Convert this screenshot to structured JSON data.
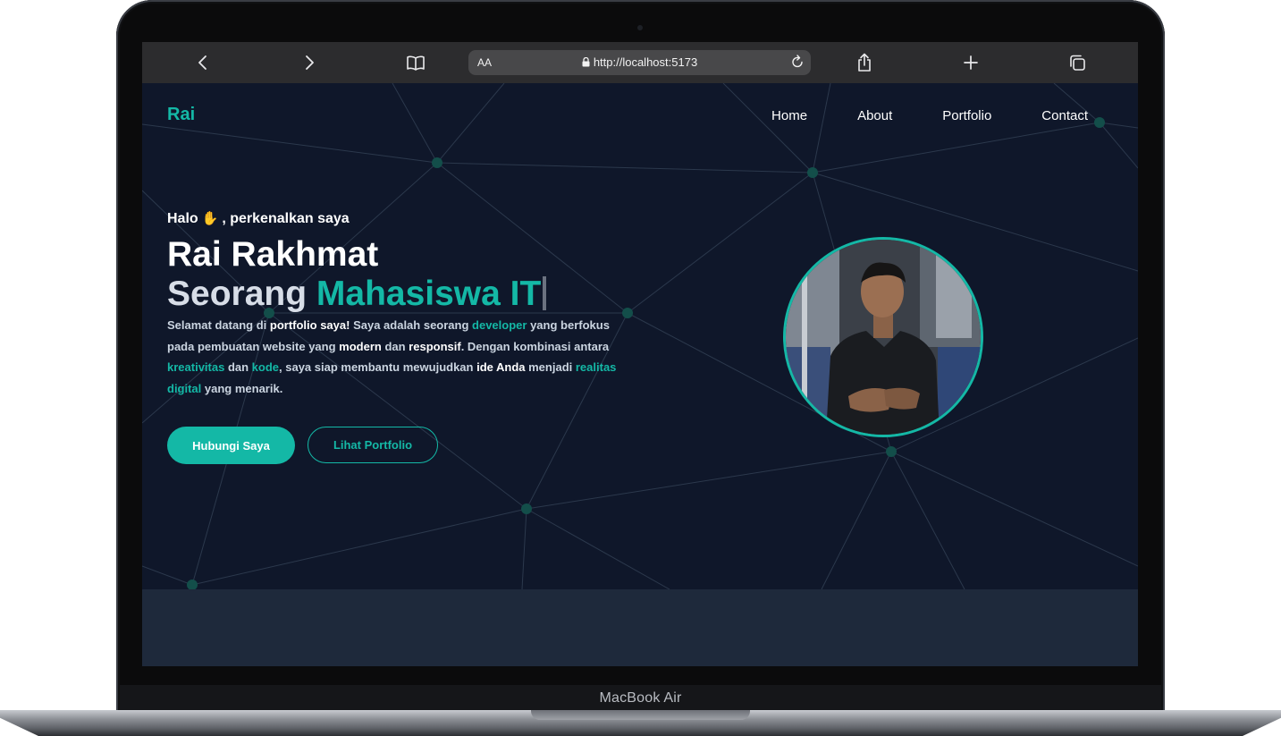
{
  "browser": {
    "url": "http://localhost:5173",
    "text_size_label": "AA"
  },
  "device_label": "MacBook Air",
  "site": {
    "logo": "Rai",
    "nav": [
      "Home",
      "About",
      "Portfolio",
      "Contact"
    ]
  },
  "hero": {
    "greeting_prefix": "Halo",
    "greeting_suffix": ", perkenalkan saya",
    "name": "Rai Rakhmat",
    "subtitle_prefix": "Seorang",
    "subtitle_accent": "Mahasiswa IT",
    "description_parts": [
      {
        "text": "Selamat datang di ",
        "style": "normal"
      },
      {
        "text": "portfolio saya!",
        "style": "white"
      },
      {
        "text": " Saya adalah seorang ",
        "style": "normal"
      },
      {
        "text": "developer",
        "style": "teal"
      },
      {
        "text": " yang berfokus pada pembuatan website yang ",
        "style": "normal"
      },
      {
        "text": "modern",
        "style": "white"
      },
      {
        "text": " dan ",
        "style": "normal"
      },
      {
        "text": "responsif",
        "style": "white"
      },
      {
        "text": ". Dengan kombinasi antara ",
        "style": "normal"
      },
      {
        "text": "kreativitas",
        "style": "teal"
      },
      {
        "text": " dan ",
        "style": "normal"
      },
      {
        "text": "kode",
        "style": "teal"
      },
      {
        "text": ", saya siap membantu mewujudkan ",
        "style": "normal"
      },
      {
        "text": "ide Anda",
        "style": "white"
      },
      {
        "text": " menjadi ",
        "style": "normal"
      },
      {
        "text": "realitas digital",
        "style": "teal"
      },
      {
        "text": " yang menarik.",
        "style": "normal"
      }
    ],
    "primary_button": "Hubungi Saya",
    "secondary_button": "Lihat Portfolio"
  },
  "colors": {
    "accent": "#14b8a6",
    "background": "#0f172a",
    "section_background": "#1e293b"
  },
  "icons": {
    "back": "chevron-left-icon",
    "forward": "chevron-right-icon",
    "reader": "book-icon",
    "lock": "lock-icon",
    "reload": "reload-icon",
    "share": "share-icon",
    "new_tab": "plus-icon",
    "tabs": "tabs-icon",
    "greeting": "waving-hand-icon"
  }
}
